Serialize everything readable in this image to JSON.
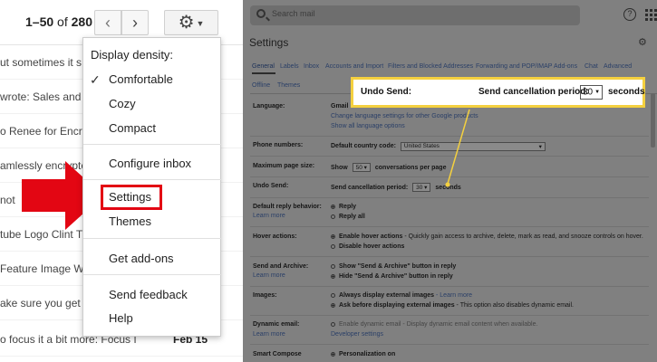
{
  "left": {
    "pager": {
      "range": "1–50",
      "of": "of",
      "total": "280"
    },
    "prev_icon": "‹",
    "next_icon": "›",
    "gear_icon": "⚙",
    "mail_rows": [
      {
        "snippet": "ut sometimes it s",
        "date": ""
      },
      {
        "snippet": "wrote: Sales and I",
        "date": ""
      },
      {
        "snippet": "o Renee for Encry",
        "date": ""
      },
      {
        "snippet": "amlessly encrypte",
        "date": ""
      },
      {
        "snippet": "not ",
        "date": ""
      },
      {
        "snippet": "tube Logo Clint Tu",
        "date": ""
      },
      {
        "snippet": " Feature Image W",
        "date": ""
      },
      {
        "snippet": "ake sure you get t",
        "date": ""
      },
      {
        "snippet": "o focus it a bit more: Focus I",
        "date": "Feb 15"
      }
    ],
    "menu": {
      "density_header": "Display density:",
      "comfortable": "Comfortable",
      "cozy": "Cozy",
      "compact": "Compact",
      "configure_inbox": "Configure inbox",
      "settings": "Settings",
      "themes": "Themes",
      "get_addons": "Get add-ons",
      "send_feedback": "Send feedback",
      "help": "Help",
      "check": "✓"
    },
    "highlight_color": "#e30613"
  },
  "right": {
    "search_placeholder": "Search mail",
    "help_icon": "?",
    "title": "Settings",
    "gear": "⚙",
    "tabs": [
      "General",
      "Labels",
      "Inbox",
      "Accounts and Import",
      "Filters and Blocked Addresses",
      "Forwarding and POP/IMAP",
      "Add-ons",
      "Chat",
      "Advanced"
    ],
    "tabs_row2": [
      "Offline",
      "Themes"
    ],
    "rows": {
      "language": {
        "label": "Language:",
        "value_prefix": "Gmail",
        "link1": "Change language settings for other Google products",
        "link2": "Show all language options"
      },
      "phone": {
        "label": "Phone numbers:",
        "text": "Default country code:",
        "select": "United States"
      },
      "page_size": {
        "label": "Maximum page size:",
        "show": "Show",
        "select": "50",
        "suffix": "conversations per page"
      },
      "undo": {
        "label": "Undo Send:",
        "text": "Send cancellation period:",
        "select": "30",
        "suffix": "seconds"
      },
      "reply": {
        "label": "Default reply behavior:",
        "learn": "Learn more",
        "opt1": "Reply",
        "opt2": "Reply all"
      },
      "hover": {
        "label": "Hover actions:",
        "opt1_bold": "Enable hover actions",
        "opt1_rest": " - Quickly gain access to archive, delete, mark as read, and snooze controls on hover.",
        "opt2_bold": "Disable hover actions"
      },
      "send_archive": {
        "label": "Send and Archive:",
        "learn": "Learn more",
        "opt1": "Show \"Send & Archive\" button in reply",
        "opt2": "Hide \"Send & Archive\" button in reply"
      },
      "images": {
        "label": "Images:",
        "opt1_bold": "Always display external images",
        "opt1_link": " - Learn more",
        "opt2_bold": "Ask before displaying external images",
        "opt2_rest": " - This option also disables dynamic email."
      },
      "dynamic": {
        "label": "Dynamic email:",
        "learn": "Learn more",
        "opt1": "Enable dynamic email - Display dynamic email content when available.",
        "link": "Developer settings"
      },
      "compose": {
        "label": "Smart Compose",
        "opt1": "Personalization on"
      }
    },
    "callout": {
      "label": "Undo Send:",
      "period": "Send cancellation period:",
      "select": "30",
      "seconds": "seconds",
      "border_color": "#f4d03f"
    }
  }
}
